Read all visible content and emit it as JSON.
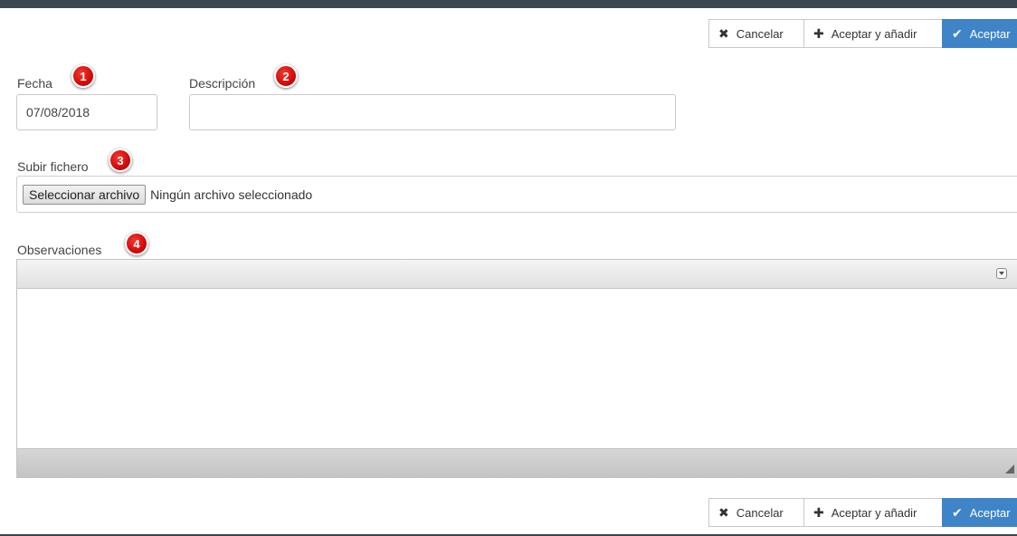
{
  "toolbar": {
    "cancel_label": "Cancelar",
    "accept_add_label": "Aceptar y añadir",
    "accept_label": "Aceptar",
    "icons": {
      "cancel": "close-icon",
      "accept_add": "plus-icon",
      "accept": "check-icon"
    }
  },
  "form": {
    "fecha": {
      "label": "Fecha",
      "value": "07/08/2018",
      "badge": "1"
    },
    "descripcion": {
      "label": "Descripción",
      "value": "",
      "badge": "2"
    },
    "subir_fichero": {
      "label": "Subir fichero",
      "button_label": "Seleccionar archivo",
      "status": "Ningún archivo seleccionado",
      "badge": "3"
    },
    "observaciones": {
      "label": "Observaciones",
      "badge": "4",
      "value": ""
    }
  },
  "colors": {
    "primary": "#3e84c7",
    "badge": "#d10a0a",
    "topbar": "#3c4653"
  }
}
